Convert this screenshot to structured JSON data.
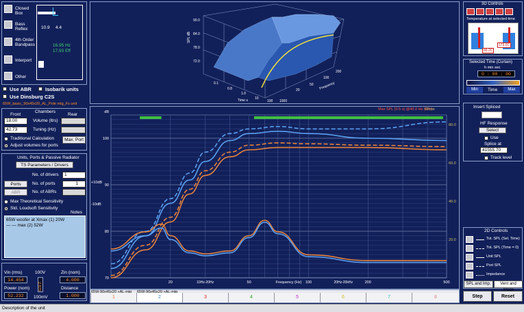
{
  "enclosure": {
    "options": [
      "Closed Box",
      "Bass Reflex",
      "4th Order Bandpass",
      "Interport",
      "Other"
    ],
    "dims": [
      "10.9",
      "4.4"
    ],
    "green_vals": [
      "16.95 Hz",
      "17.93 Eff"
    ],
    "checks": [
      "Use ABR",
      "Isobarik units",
      "Use Dinsburg C2S"
    ],
    "file_label": "65W_basic_90x45x20_AL_Pole mtg_Fs unit"
  },
  "chambers": {
    "title": "Chambers",
    "front": "Front",
    "rear": "Rear",
    "volume_value": "18.00",
    "volume_label": "Volume (ltrs)",
    "tuning_value": "42.73",
    "tuning_label": "Tuning (Hz)",
    "max_port_btn": "Max. Port",
    "traditional": "Traditional Calculation",
    "adjust": "Adjust volumes for ports"
  },
  "units": {
    "title": "Units, Ports & Passive Radiator",
    "dropdown": "TS Parameters / Drivers",
    "no_drivers_label": "No. of drivers",
    "no_drivers_value": "1",
    "ports_btn": "Ports",
    "no_ports_label": "No. of ports",
    "no_ports_value": "1",
    "abr_btn": "ABR",
    "no_abrs_label": "No. of ABRs",
    "max_sens": "Max Theoretical Sensitivity",
    "std_sens": "Std. Loudsoft Sensitivity",
    "notes_label": "Notes",
    "notes_line1": "65W woofer at Xmax (1) 20W",
    "notes_line2": "— — max (2) 52W"
  },
  "bottom_left": {
    "vin_label": "Vin (rms)",
    "vin_value": "14.454",
    "voltage_label": "100V",
    "zin_label": "Zin (nom)",
    "zin_value": "4.000",
    "power_label": "Power (nom)",
    "power_value": "52.232",
    "meter_value": "2.879",
    "volt_bottom": "100mV",
    "distance_label": "Distance",
    "distance_value": "1.000"
  },
  "plot3d": {
    "z_ticks": [
      "90.0",
      "84.0",
      "78.0",
      "72.0"
    ],
    "z_label": "SPL dB",
    "x_ticks": [
      "0.1",
      "0.8",
      "1.0",
      "10",
      "100",
      "1000"
    ],
    "x_label": "Time s",
    "y_ticks": [
      "20",
      "50",
      "100",
      "200"
    ],
    "y_label": "Frequency"
  },
  "chart_data": {
    "type": "line",
    "xscale": "log",
    "xlim": [
      10,
      500
    ],
    "xlabel": "Frequency (Hz)",
    "ylabel_left": "dB",
    "ylim_left": [
      70,
      105
    ],
    "yticks_left": [
      "100",
      "90",
      "80",
      "70"
    ],
    "ylabel_right": "Ohms",
    "yticks_right": [
      "80.0",
      "60.0",
      "40.0",
      "20.0"
    ],
    "x_ticks": [
      "20",
      "50",
      "100",
      "200",
      "500"
    ],
    "x_annotations": [
      "10Hz-20Hz",
      "20Hz-20kHz"
    ],
    "side_labels": [
      "+10dB",
      "-10dB"
    ],
    "header_red": "Max SPL (0.5 s) @40.0 Hz (Wtr)",
    "series": [
      {
        "name": "Tot. SPL (Sel. Time)",
        "color": "#5aa0f0",
        "dash": false,
        "x": [
          10,
          15,
          20,
          25,
          30,
          40,
          50,
          70,
          100,
          200,
          500
        ],
        "y": [
          72.0,
          79.0,
          86.0,
          91.0,
          95.0,
          99.5,
          101.0,
          101.5,
          101.0,
          100.0,
          99.5
        ]
      },
      {
        "name": "Tot. SPL (Time = 0)",
        "color": "#5aa0f0",
        "dash": true,
        "x": [
          10,
          15,
          20,
          25,
          30,
          40,
          50,
          70,
          100,
          200,
          500
        ],
        "y": [
          73.0,
          80.0,
          87.0,
          92.5,
          97.0,
          101.0,
          102.0,
          102.5,
          102.0,
          102.0,
          103.5
        ]
      },
      {
        "name": "Unit SPL",
        "color": "#e8823a",
        "dash": false,
        "x": [
          10,
          15,
          20,
          25,
          30,
          40,
          50,
          70,
          100,
          200,
          500
        ],
        "y": [
          70.0,
          76.0,
          82.0,
          88.0,
          92.0,
          96.0,
          97.5,
          98.0,
          98.0,
          98.0,
          97.5
        ]
      },
      {
        "name": "Port SPL",
        "color": "#e8823a",
        "dash": true,
        "x": [
          10,
          15,
          20,
          25,
          30,
          40,
          50,
          70,
          100,
          200,
          500
        ],
        "y": [
          70.5,
          77.0,
          83.0,
          89.0,
          93.0,
          97.0,
          98.5,
          99.0,
          98.8,
          98.5,
          98.2
        ]
      },
      {
        "name": "Impedance",
        "color": "#e8823a",
        "dash": false,
        "x": [
          10,
          15,
          18,
          20,
          25,
          30,
          40,
          50,
          60,
          70,
          100,
          200,
          500
        ],
        "y": [
          15.0,
          24.0,
          28.0,
          22.0,
          14.0,
          12.5,
          14.0,
          22.0,
          30.0,
          24.0,
          12.0,
          9.0,
          9.0
        ]
      },
      {
        "name": "Impedance (blue)",
        "color": "#5aa0f0",
        "dash": false,
        "x": [
          10,
          15,
          18,
          20,
          25,
          30,
          40,
          50,
          60,
          70,
          100,
          200,
          500
        ],
        "y": [
          14.0,
          22.0,
          26.0,
          20.0,
          13.0,
          11.5,
          13.0,
          21.0,
          29.0,
          23.0,
          11.0,
          8.0,
          8.0
        ]
      }
    ]
  },
  "controls3d": {
    "title": "3D Controls",
    "temp_title": "Temperature at selected time",
    "temp_left": "86.2C",
    "temp_right": "179.6C",
    "curtain_title": "Selected Time (Curtain)",
    "curtain_units": "h  min  sec",
    "curtain_value": "0 : 00 : 00",
    "slider_min": "Min",
    "slider_mid": "Time",
    "slider_max": "Max"
  },
  "spliced": {
    "title": "Insert Spliced",
    "hf_label": "HF Response",
    "select_btn": "Select",
    "use_label": "Use",
    "splice_label": "Splice at",
    "splice_value": "41555.70",
    "track_label": "Track level"
  },
  "controls2d": {
    "title": "2D Controls",
    "legend": [
      "Tot. SPL (Sel. Time)",
      "Tot. SPL (Time = 0)",
      "Unit SPL",
      "Port SPL",
      "Impedance"
    ],
    "tabs": [
      "SPL and Imp.",
      "Vent and Xmax"
    ]
  },
  "bottom": {
    "file_tabs": [
      "65W-90x45x20 +AL-mtg",
      "65W-90x45x20 +AL-mtg"
    ],
    "numbered_tabs": [
      "1",
      "2",
      "3",
      "4",
      "5",
      "6",
      "7",
      "8"
    ],
    "step_btn": "Step",
    "reset_btn": "Reset",
    "status": "Description of the unit"
  }
}
